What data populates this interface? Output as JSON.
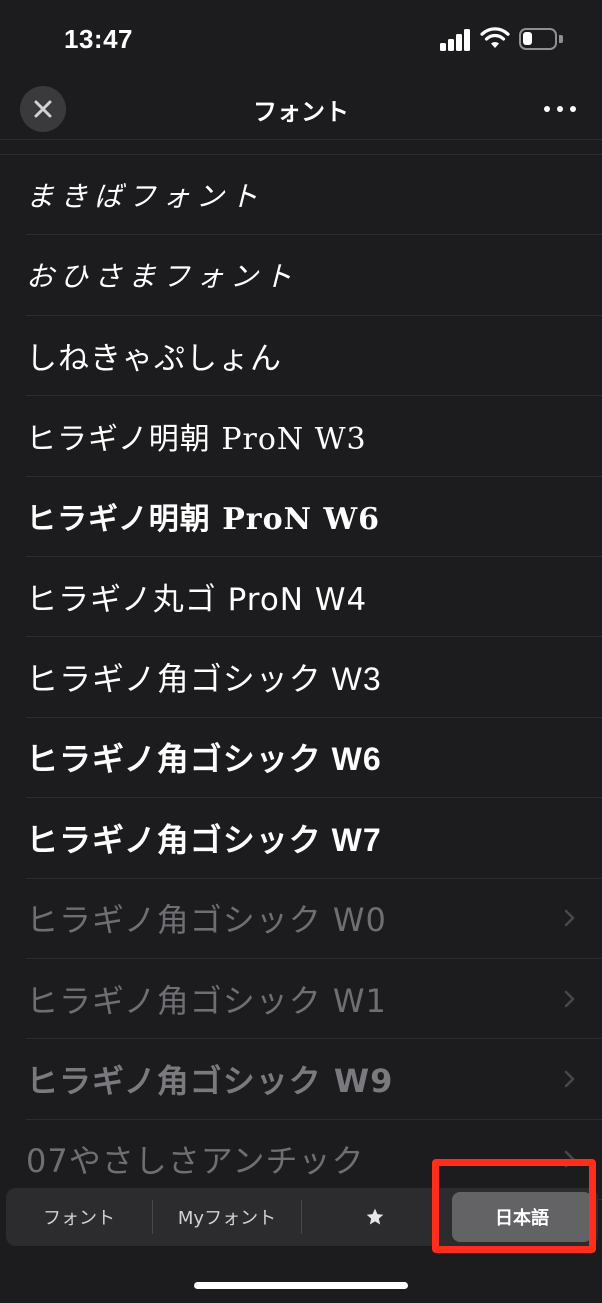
{
  "status_bar": {
    "time": "13:47",
    "signal_icon": "cellular-signal-icon",
    "wifi_icon": "wifi-icon",
    "battery_icon": "battery-icon",
    "battery_level": 0.3
  },
  "header": {
    "title": "フォント",
    "close_icon": "close-icon",
    "more_icon": "more-horizontal-icon"
  },
  "fonts": [
    {
      "label": "まきばフォント",
      "style": "hand",
      "enabled": true
    },
    {
      "label": "おひさまフォント",
      "style": "hand",
      "enabled": true
    },
    {
      "label": "しねきゃぷしょん",
      "style": "round",
      "enabled": true
    },
    {
      "label": "ヒラギノ明朝 ProN W3",
      "style": "mincho",
      "enabled": true
    },
    {
      "label": "ヒラギノ明朝 ProN W6",
      "style": "mincho-bold",
      "enabled": true
    },
    {
      "label": "ヒラギノ丸ゴ ProN W4",
      "style": "round",
      "enabled": true
    },
    {
      "label": "ヒラギノ角ゴシック W3",
      "style": "gothic",
      "enabled": true
    },
    {
      "label": "ヒラギノ角ゴシック W6",
      "style": "gothic-bold",
      "enabled": true
    },
    {
      "label": "ヒラギノ角ゴシック W7",
      "style": "gothic-bold",
      "enabled": true
    },
    {
      "label": "ヒラギノ角ゴシック W0",
      "style": "dim",
      "enabled": false
    },
    {
      "label": "ヒラギノ角ゴシック W1",
      "style": "dim",
      "enabled": false
    },
    {
      "label": "ヒラギノ角ゴシック W9",
      "style": "dim heavy",
      "enabled": false
    },
    {
      "label": "07やさしさアンチック",
      "style": "dim",
      "enabled": false
    }
  ],
  "tabs": {
    "fonts": "フォント",
    "my_fonts": "Myフォント",
    "favorites_icon": "star-icon",
    "japanese": "日本語",
    "active": "japanese"
  },
  "colors": {
    "background": "#1c1c1e",
    "highlight": "#ff2d1a",
    "disabled_text": "#6e6e73"
  }
}
